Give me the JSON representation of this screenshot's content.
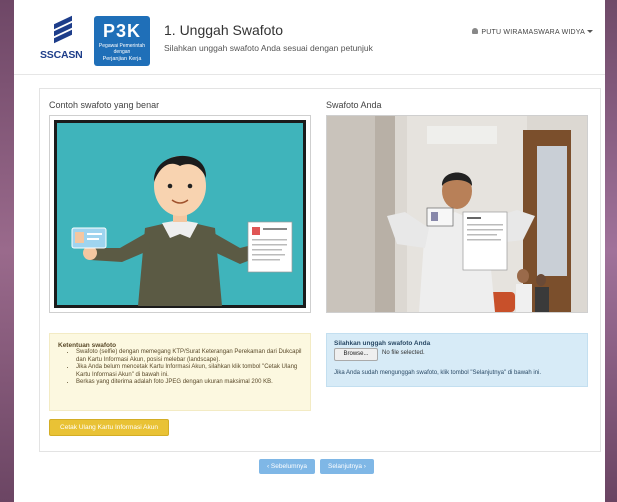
{
  "header": {
    "ssc_logo_text": "SSCASN",
    "p3k_logo_text": "P3K",
    "p3k_logo_small": "Pegawai Pemerintah dengan",
    "p3k_logo_sub": "Perjanjian Kerja",
    "title": "1. Unggah Swafoto",
    "subtitle": "Silahkan unggah swafoto Anda sesuai dengan petunjuk",
    "user_name": "PUTU WIRAMASWARA WIDYA"
  },
  "left": {
    "label": "Contoh swafoto yang benar"
  },
  "right": {
    "label": "Swafoto Anda"
  },
  "rules": {
    "title": "Ketentuan swafoto",
    "items": [
      "Swafoto (selfie) dengan memegang KTP/Surat Keterangan Perekaman dari Dukcapil dan Kartu Informasi Akun, posisi melebar (landscape).",
      "Jika Anda belum mencetak Kartu Informasi Akun, silahkan klik tombol \"Cetak Ulang Kartu Informasi Akun\" di bawah ini.",
      "Berkas yang diterima adalah foto JPEG dengan ukuran maksimal 200 KB."
    ]
  },
  "upload": {
    "title": "Silahkan unggah swafoto Anda",
    "browse_label": "Browse...",
    "file_status": "No file selected.",
    "note": "Jika Anda sudah mengunggah swafoto, klik tombol \"Selanjutnya\" di bawah ini."
  },
  "buttons": {
    "print_card": "Cetak Ulang Kartu Informasi Akun",
    "prev": "‹ Sebelumnya",
    "next": "Selanjutnya ›"
  },
  "colors": {
    "brand_blue": "#1f6fb8",
    "warning_bg": "#fcf8e0",
    "info_bg": "#d7ebf7",
    "warning_button": "#e9c235",
    "nav_button": "#7fb7e6"
  }
}
